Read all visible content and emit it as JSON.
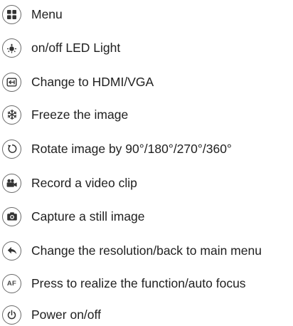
{
  "items": [
    {
      "icon": "menu-grid-icon",
      "label": "Menu"
    },
    {
      "icon": "led-light-icon",
      "label": "on/off LED Light"
    },
    {
      "icon": "input-switch-icon",
      "label": "Change to HDMI/VGA"
    },
    {
      "icon": "snowflake-icon",
      "label": "Freeze the image"
    },
    {
      "icon": "rotate-icon",
      "label": "Rotate image by 90°/180°/270°/360°"
    },
    {
      "icon": "video-camera-icon",
      "label": "Record a video clip"
    },
    {
      "icon": "camera-icon",
      "label": "Capture a still image"
    },
    {
      "icon": "back-arrow-icon",
      "label": "Change the resolution/back to main menu"
    },
    {
      "icon": "autofocus-icon",
      "label": "Press to realize the function/auto focus",
      "icon_text": "AF"
    },
    {
      "icon": "power-icon",
      "label": "Power on/off"
    }
  ],
  "colors": {
    "icon_stroke": "#6a6a6a",
    "icon_fill": "#333333",
    "text": "#1f1f1f"
  }
}
